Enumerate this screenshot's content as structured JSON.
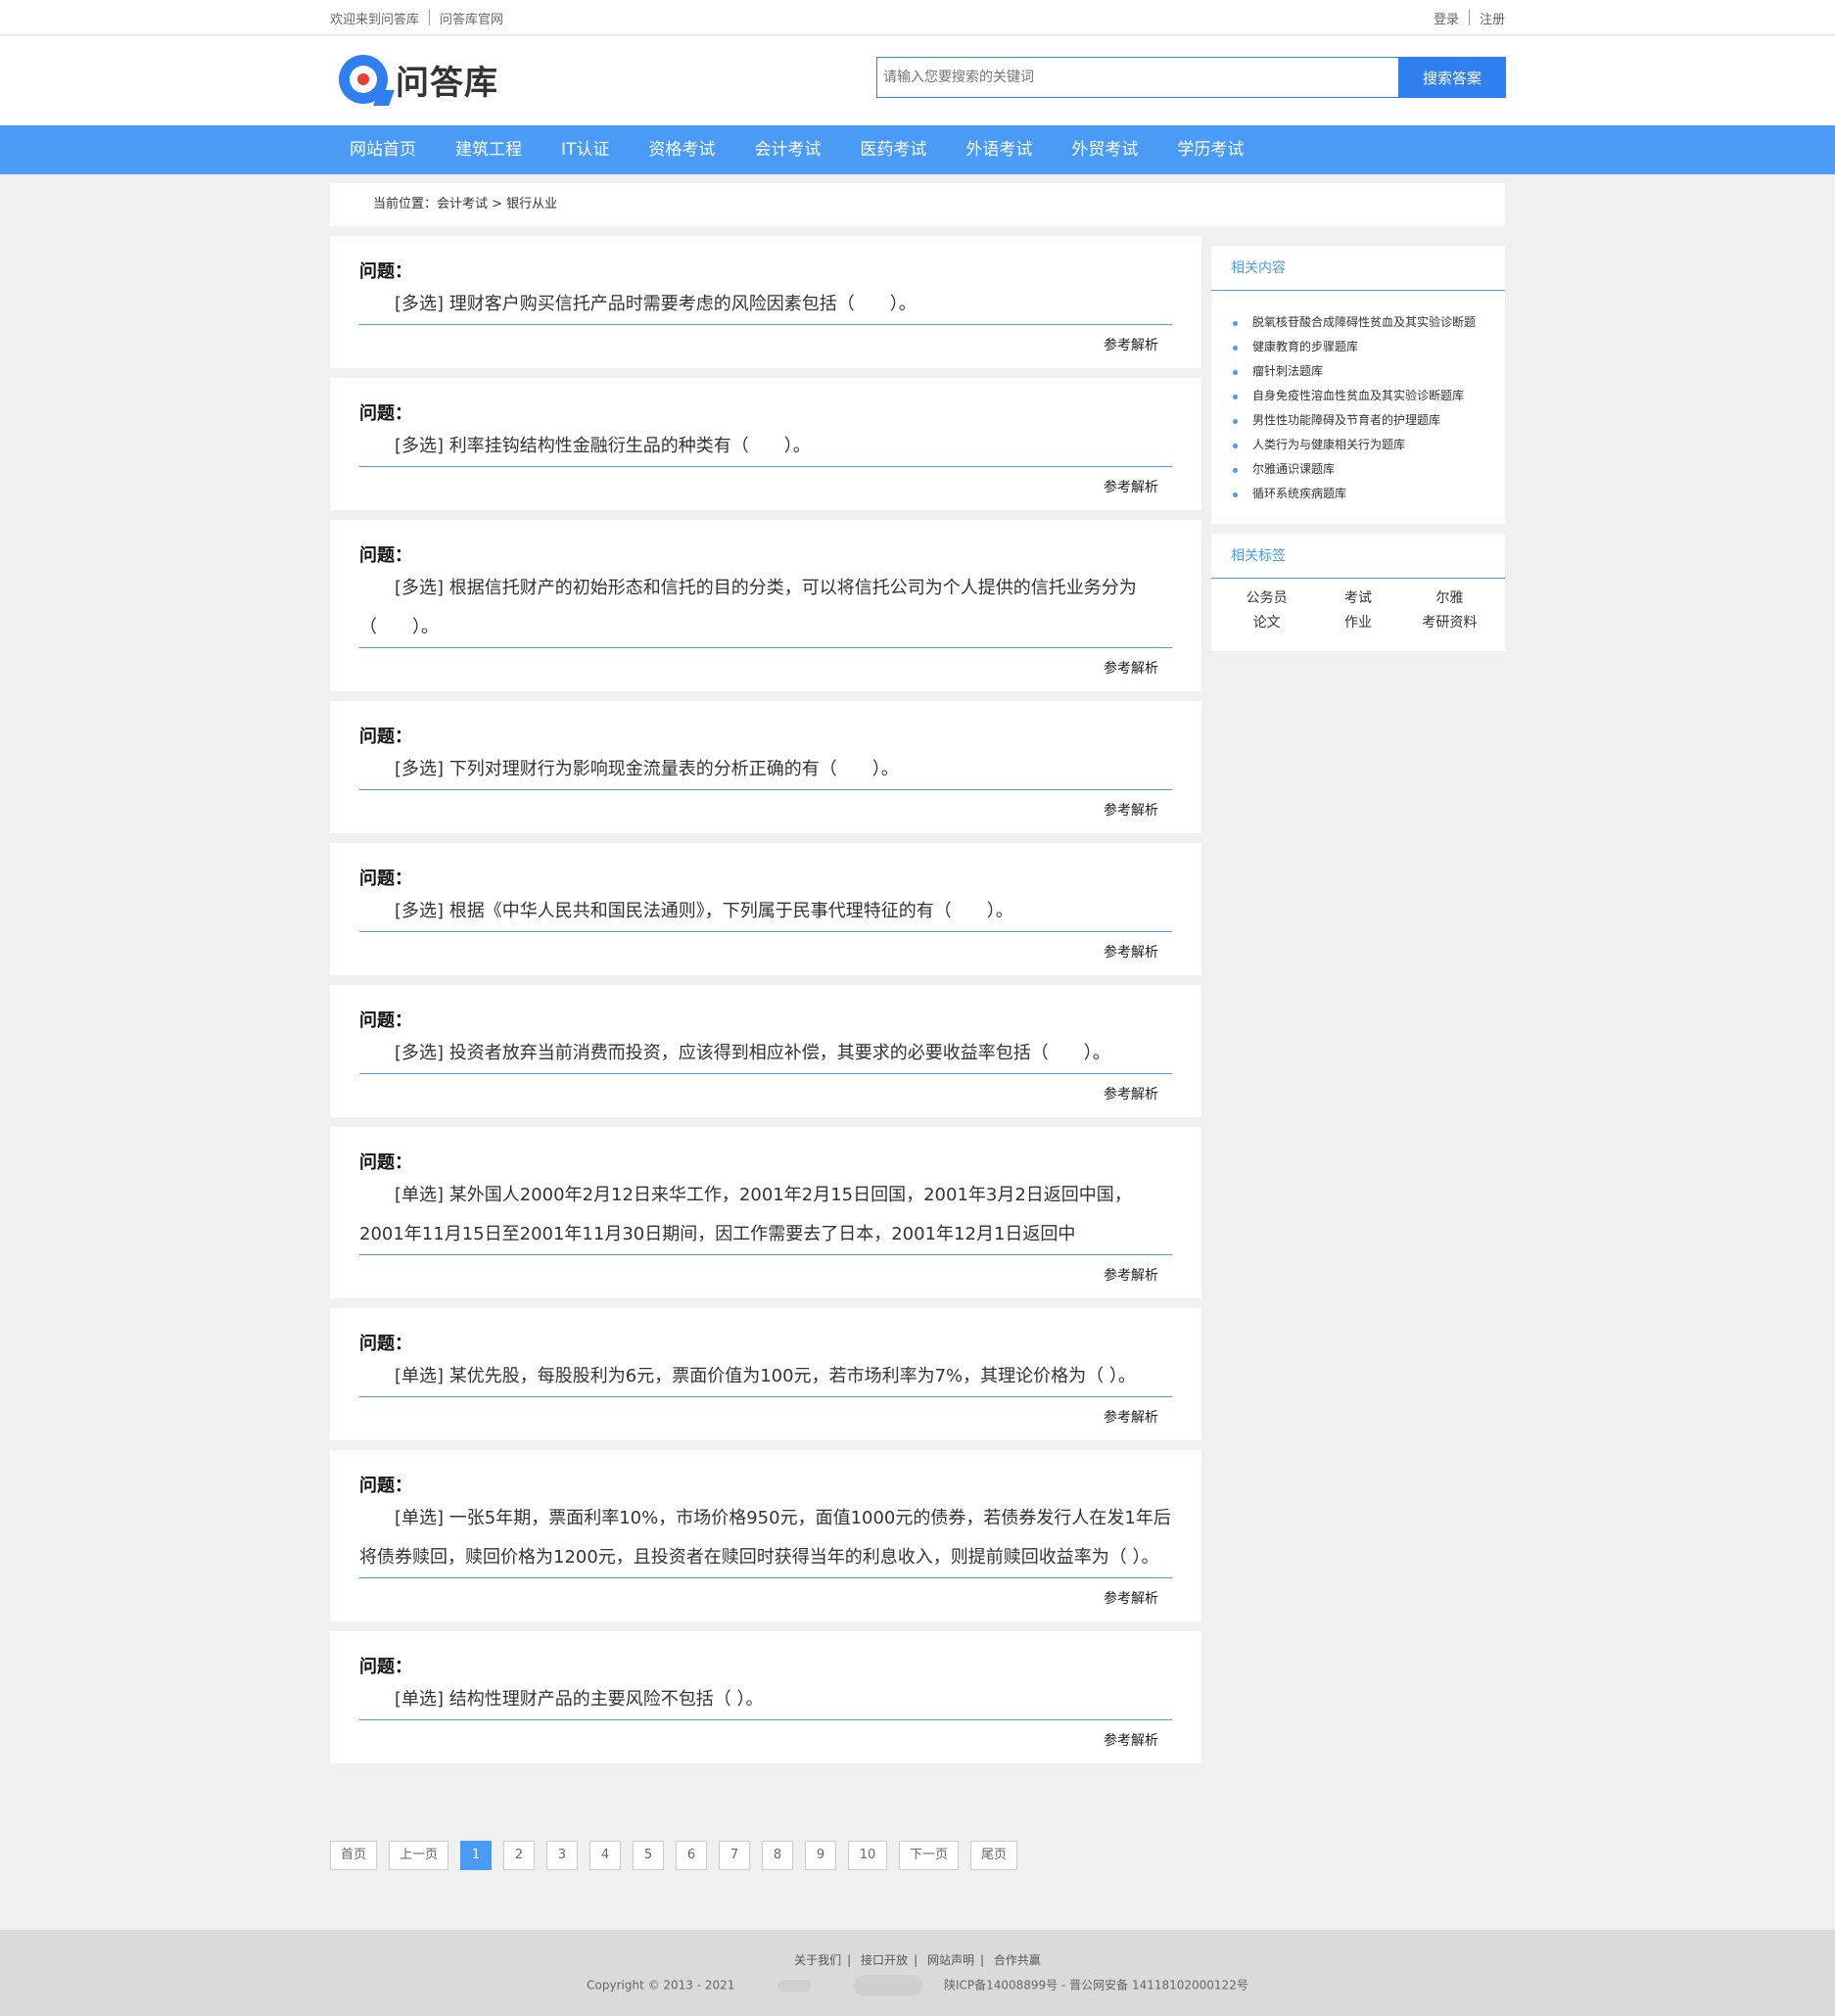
{
  "topbar": {
    "welcome": "欢迎来到问答库",
    "official": "问答库官网",
    "login": "登录",
    "register": "注册"
  },
  "header": {
    "logo_text": "问答库",
    "search_placeholder": "请输入您要搜索的关键词",
    "search_button": "搜索答案"
  },
  "nav": [
    "网站首页",
    "建筑工程",
    "IT认证",
    "资格考试",
    "会计考试",
    "医药考试",
    "外语考试",
    "外贸考试",
    "学历考试"
  ],
  "breadcrumb": "当前位置：会计考试 > 银行从业",
  "questions": [
    {
      "label": "问题：",
      "text": "[多选] 理财客户购买信托产品时需要考虑的风险因素包括（　　）。",
      "link": "参考解析"
    },
    {
      "label": "问题：",
      "text": "[多选] 利率挂钩结构性金融衍生品的种类有（　　）。",
      "link": "参考解析"
    },
    {
      "label": "问题：",
      "text": "[多选] 根据信托财产的初始形态和信托的目的分类，可以将信托公司为个人提供的信托业务分为（　　）。",
      "link": "参考解析"
    },
    {
      "label": "问题：",
      "text": "[多选] 下列对理财行为影响现金流量表的分析正确的有（　　）。",
      "link": "参考解析"
    },
    {
      "label": "问题：",
      "text": "[多选] 根据《中华人民共和国民法通则》，下列属于民事代理特征的有（　　）。",
      "link": "参考解析"
    },
    {
      "label": "问题：",
      "text": "[多选] 投资者放弃当前消费而投资，应该得到相应补偿，其要求的必要收益率包括（　　）。",
      "link": "参考解析"
    },
    {
      "label": "问题：",
      "text": "[单选] 某外国人2000年2月12日来华工作，2001年2月15日回国，2001年3月2日返回中国，2001年11月15日至2001年11月30日期间，因工作需要去了日本，2001年12月1日返回中",
      "link": "参考解析"
    },
    {
      "label": "问题：",
      "text": "[单选] 某优先股，每股股利为6元，票面价值为100元，若市场利率为7%，其理论价格为（ ）。",
      "link": "参考解析"
    },
    {
      "label": "问题：",
      "text": "[单选] 一张5年期，票面利率10%，市场价格950元，面值1000元的债券，若债券发行人在发1年后将债券赎回，赎回价格为1200元，且投资者在赎回时获得当年的利息收入，则提前赎回收益率为（ ）。",
      "link": "参考解析"
    },
    {
      "label": "问题：",
      "text": "[单选] 结构性理财产品的主要风险不包括（ ）。",
      "link": "参考解析"
    }
  ],
  "pager": {
    "first": "首页",
    "prev": "上一页",
    "pages": [
      "1",
      "2",
      "3",
      "4",
      "5",
      "6",
      "7",
      "8",
      "9",
      "10"
    ],
    "next": "下一页",
    "last": "尾页",
    "current": "1"
  },
  "sidebar": {
    "related_title": "相关内容",
    "related": [
      "脱氧核苷酸合成障碍性贫血及其实验诊断题",
      "健康教育的步骤题库",
      "瘤针刺法题库",
      "自身免疫性溶血性贫血及其实验诊断题库",
      "男性性功能障碍及节育者的护理题库",
      "人类行为与健康相关行为题库",
      "尔雅通识课题库",
      "循环系统疾病题库"
    ],
    "tags_title": "相关标签",
    "tags": [
      "公务员",
      "考试",
      "尔雅",
      "论文",
      "作业",
      "考研资料"
    ]
  },
  "footer": {
    "links": [
      "关于我们",
      "接口开放",
      "网站声明",
      "合作共赢"
    ],
    "copyright": "Copyright © 2013 - 2021",
    "icp": "陕ICP备14008899号 - 晋公网安备 14118102000122号"
  }
}
